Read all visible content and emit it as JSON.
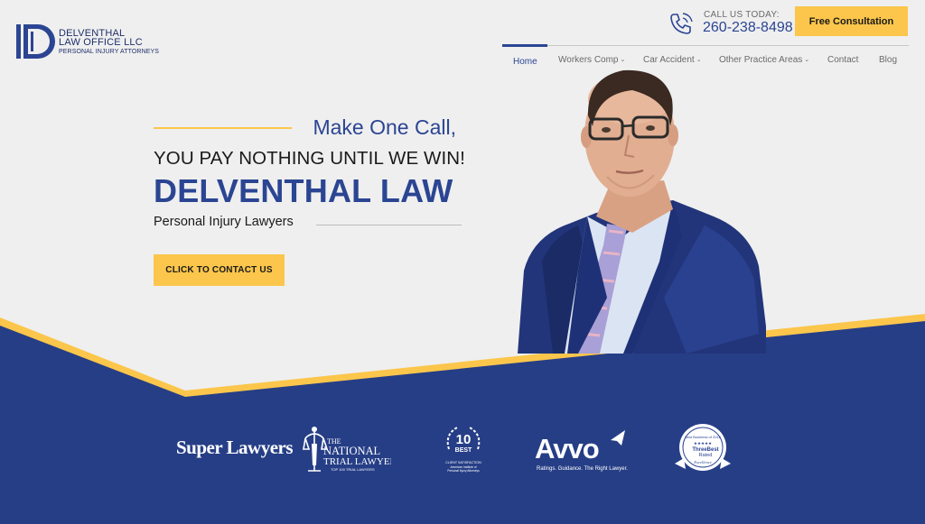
{
  "header": {
    "logo": {
      "line1": "DELVENTHAL",
      "line2": "LAW OFFICE LLC",
      "line3": "PERSONAL INJURY ATTORNEYS"
    },
    "call": {
      "label": "CALL US TODAY:",
      "number": "260-238-8498"
    },
    "consultation_button": "Free Consultation"
  },
  "nav": {
    "items": [
      {
        "label": "Home",
        "active": true,
        "dropdown": false
      },
      {
        "label": "Workers Comp",
        "active": false,
        "dropdown": true
      },
      {
        "label": "Car Accident",
        "active": false,
        "dropdown": true
      },
      {
        "label": "Other Practice Areas",
        "active": false,
        "dropdown": true
      },
      {
        "label": "Contact",
        "active": false,
        "dropdown": false
      },
      {
        "label": "Blog",
        "active": false,
        "dropdown": false
      }
    ]
  },
  "hero": {
    "tagline": "Make One Call,",
    "subhead": "YOU PAY NOTHING UNTIL WE WIN!",
    "firm_name": "DELVENTHAL LAW",
    "description": "Personal Injury Lawyers",
    "cta": "CLICK TO CONTACT US"
  },
  "badges": {
    "super_lawyers": "Super Lawyers",
    "national_trial_lawyers": {
      "line1": "THE",
      "line2": "NATIONAL",
      "line3": "TRIAL LAWYERS",
      "line4": "TOP 100 TRIAL LAWYERS"
    },
    "ten_best": {
      "number": "10",
      "word": "BEST",
      "line1": "CLIENT SATISFACTION",
      "line2": "American Institute of",
      "line3": "Personal Injury Attorneys"
    },
    "avvo": {
      "name": "Avvo",
      "tagline": "Ratings. Guidance. The Right Lawyer."
    },
    "three_best": {
      "line1": "Best Business of 2018",
      "line2": "ThreeBest",
      "line3": "Rated",
      "line4": "Excellence"
    }
  },
  "colors": {
    "navy": "#2b4593",
    "gold": "#fbc64b",
    "background": "#efefef"
  }
}
